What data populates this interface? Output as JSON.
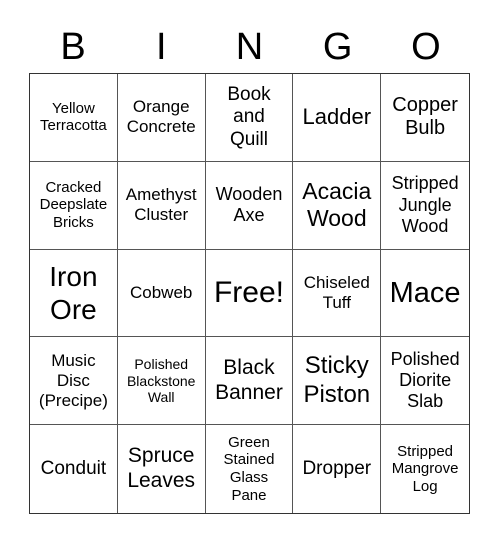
{
  "header": {
    "letters": [
      "B",
      "I",
      "N",
      "G",
      "O"
    ]
  },
  "cells": [
    {
      "text": "Yellow\nTerracotta",
      "size": "s15"
    },
    {
      "text": "Orange\nConcrete",
      "size": "s17"
    },
    {
      "text": "Book\nand\nQuill",
      "size": "s19"
    },
    {
      "text": "Ladder",
      "size": "s22"
    },
    {
      "text": "Copper\nBulb",
      "size": "s20"
    },
    {
      "text": "Cracked\nDeepslate\nBricks",
      "size": "s15"
    },
    {
      "text": "Amethyst\nCluster",
      "size": "s17"
    },
    {
      "text": "Wooden\nAxe",
      "size": "s18"
    },
    {
      "text": "Acacia\nWood",
      "size": "s23"
    },
    {
      "text": "Stripped\nJungle\nWood",
      "size": "s18"
    },
    {
      "text": "Iron\nOre",
      "size": "s28"
    },
    {
      "text": "Cobweb",
      "size": "s17"
    },
    {
      "text": "Free!",
      "size": "s30"
    },
    {
      "text": "Chiseled\nTuff",
      "size": "s17"
    },
    {
      "text": "Mace",
      "size": "s29"
    },
    {
      "text": "Music\nDisc\n(Precipe)",
      "size": "s17"
    },
    {
      "text": "Polished\nBlackstone\nWall",
      "size": "s14"
    },
    {
      "text": "Black\nBanner",
      "size": "s21"
    },
    {
      "text": "Sticky\nPiston",
      "size": "s24"
    },
    {
      "text": "Polished\nDiorite\nSlab",
      "size": "s18"
    },
    {
      "text": "Conduit",
      "size": "s19"
    },
    {
      "text": "Spruce\nLeaves",
      "size": "s21"
    },
    {
      "text": "Green\nStained\nGlass\nPane",
      "size": "s15"
    },
    {
      "text": "Dropper",
      "size": "s19"
    },
    {
      "text": "Stripped\nMangrove\nLog",
      "size": "s15"
    }
  ]
}
